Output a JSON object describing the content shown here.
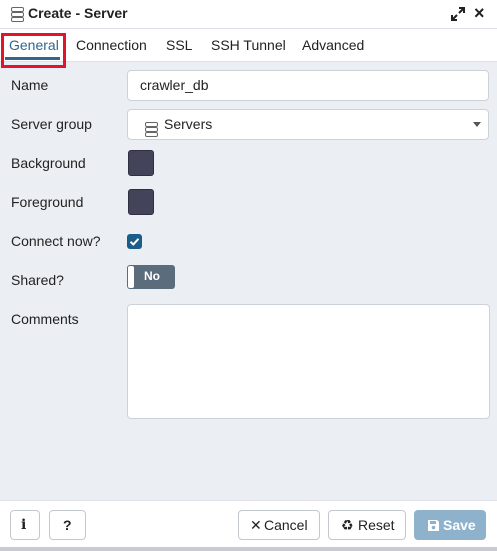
{
  "dialog": {
    "title": "Create - Server",
    "icons": {
      "title": "server-icon",
      "maximize": "expand-icon",
      "close": "close-icon"
    }
  },
  "tabs": [
    {
      "label": "General",
      "active": true
    },
    {
      "label": "Connection",
      "active": false
    },
    {
      "label": "SSL",
      "active": false
    },
    {
      "label": "SSH Tunnel",
      "active": false
    },
    {
      "label": "Advanced",
      "active": false
    }
  ],
  "form": {
    "name": {
      "label": "Name",
      "value": "crawler_db"
    },
    "server_group": {
      "label": "Server group",
      "value": "Servers",
      "icon": "server-icon"
    },
    "background": {
      "label": "Background",
      "color": "#434359"
    },
    "foreground": {
      "label": "Foreground",
      "color": "#434359"
    },
    "connect_now": {
      "label": "Connect now?",
      "checked": true
    },
    "shared": {
      "label": "Shared?",
      "value": "No"
    },
    "comments": {
      "label": "Comments",
      "value": ""
    }
  },
  "footer": {
    "info_icon": "info-icon",
    "help_label": "?",
    "cancel_label": "Cancel",
    "reset_label": "Reset",
    "save_label": "Save"
  },
  "colors": {
    "accent": "#326690",
    "highlight": "#e0142b",
    "save_button": "#8eb1cc"
  }
}
